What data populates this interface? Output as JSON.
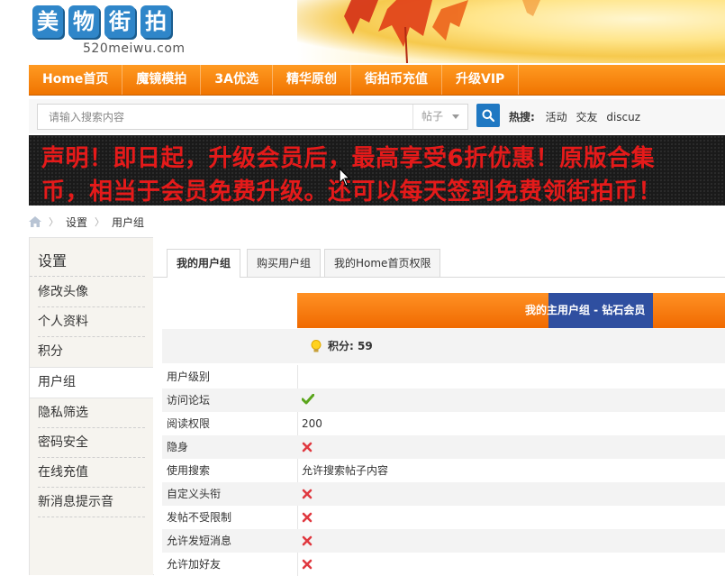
{
  "header": {
    "logo_chars": [
      "美",
      "物",
      "街",
      "拍"
    ],
    "logo_url": "520meiwu.com"
  },
  "nav": {
    "items": [
      "Home首页",
      "魔镜模拍",
      "3A优选",
      "精华原创",
      "街拍币充值",
      "升级VIP"
    ]
  },
  "search": {
    "placeholder": "请输入搜索内容",
    "type": "帖子",
    "hot_label": "热搜:",
    "hot_terms": [
      "活动",
      "交友",
      "discuz"
    ]
  },
  "banner": {
    "line1": "声明！即日起，升级会员后，最高享受6折优惠！原版合集",
    "line2": "币，相当于会员免费升级。还可以每天签到免费领街拍币！"
  },
  "breadcrumb": {
    "items": [
      "设置",
      "用户组"
    ]
  },
  "sidebar": {
    "title": "设置",
    "items": [
      "修改头像",
      "个人资料",
      "积分",
      "用户组",
      "隐私筛选",
      "密码安全",
      "在线充值",
      "新消息提示音"
    ],
    "active_index": 3
  },
  "tabs": {
    "items": [
      "我的用户组",
      "购买用户组",
      "我的Home首页权限"
    ],
    "active_index": 0
  },
  "usergroup": {
    "header": "我的主用户组 - 钻石会员",
    "points_label": "积分: 59"
  },
  "rows": [
    {
      "label": "用户级别",
      "value": "",
      "icon": ""
    },
    {
      "label": "访问论坛",
      "value": "",
      "icon": "check-icon"
    },
    {
      "label": "阅读权限",
      "value": "200",
      "icon": ""
    },
    {
      "label": "隐身",
      "value": "",
      "icon": "cross-icon"
    },
    {
      "label": "使用搜索",
      "value": "允许搜索帖子内容",
      "icon": ""
    },
    {
      "label": "自定义头衔",
      "value": "",
      "icon": "cross-icon"
    },
    {
      "label": "发帖不受限制",
      "value": "",
      "icon": "cross-icon"
    },
    {
      "label": "允许发短消息",
      "value": "",
      "icon": "cross-icon"
    },
    {
      "label": "允许加好友",
      "value": "",
      "icon": "cross-icon"
    }
  ],
  "colors": {
    "nav_orange": "#f07400",
    "link_blue": "#1f78c2",
    "banner_red": "#e51a1a",
    "usergroup_blue": "#2f4fa0",
    "check_green": "#5aa51c",
    "cross_red": "#e0383f"
  }
}
